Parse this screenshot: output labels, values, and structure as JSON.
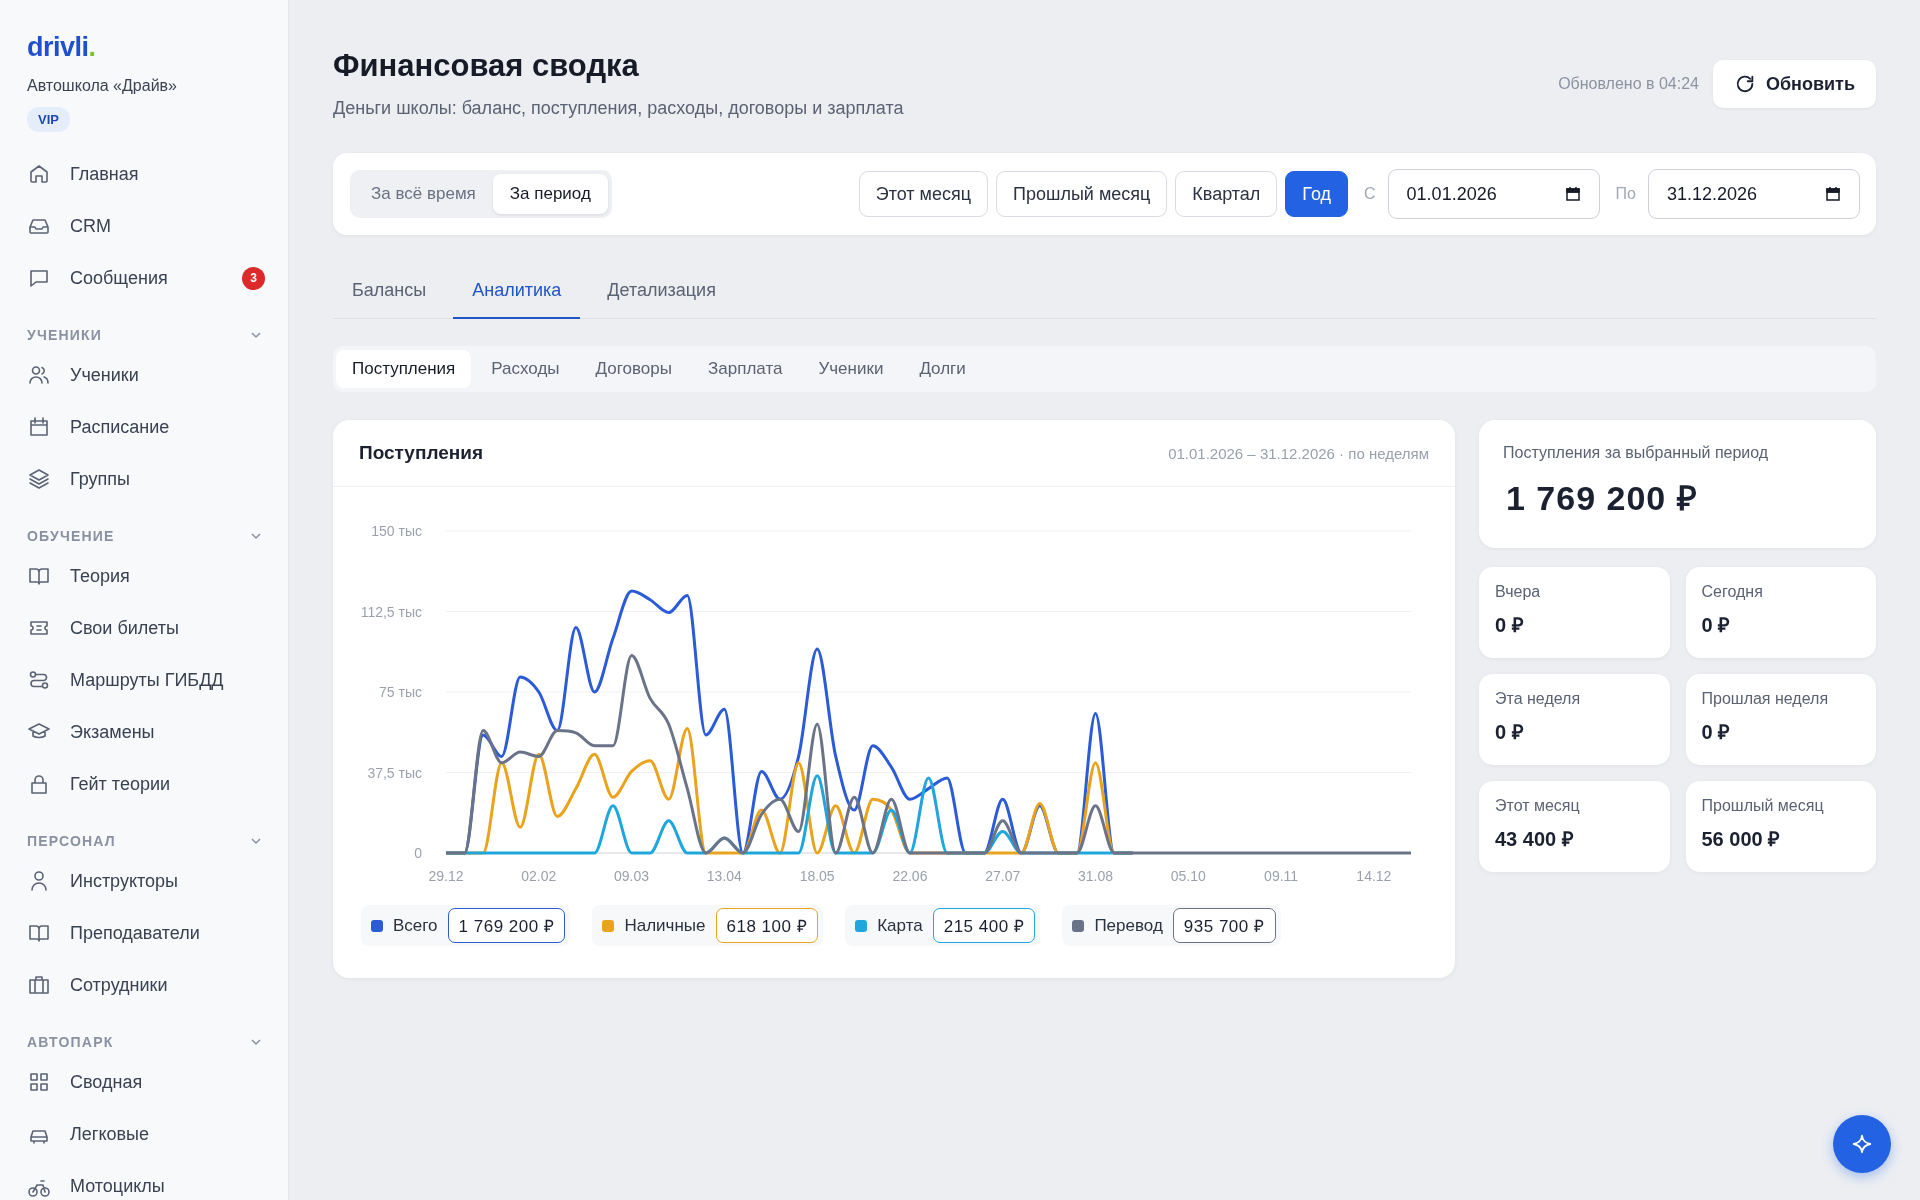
{
  "sidebar": {
    "logo": {
      "text": "drivli",
      "mark": "."
    },
    "school": "Автошкола «Драйв»",
    "plan": "VIP",
    "top_items": [
      {
        "label": "Главная"
      },
      {
        "label": "CRM"
      },
      {
        "label": "Сообщения",
        "badge": "3"
      }
    ],
    "sections": [
      {
        "title": "УЧЕНИКИ",
        "expanded": true,
        "items": [
          {
            "label": "Ученики"
          },
          {
            "label": "Расписание"
          },
          {
            "label": "Группы"
          }
        ]
      },
      {
        "title": "ОБУЧЕНИЕ",
        "expanded": true,
        "items": [
          {
            "label": "Теория"
          },
          {
            "label": "Свои билеты"
          },
          {
            "label": "Маршруты ГИБДД"
          },
          {
            "label": "Экзамены"
          },
          {
            "label": "Гейт теории"
          }
        ]
      },
      {
        "title": "ПЕРСОНАЛ",
        "expanded": true,
        "items": [
          {
            "label": "Инструкторы"
          },
          {
            "label": "Преподаватели"
          },
          {
            "label": "Сотрудники"
          }
        ]
      },
      {
        "title": "АВТОПАРК",
        "expanded": true,
        "items": [
          {
            "label": "Сводная"
          },
          {
            "label": "Легковые"
          },
          {
            "label": "Мотоциклы"
          }
        ]
      }
    ]
  },
  "header": {
    "title": "Финансовая сводка",
    "subtitle": "Деньги школы: баланс, поступления, расходы, договоры и зарплата",
    "updated": "Обновлено в 04:24",
    "refresh": "Обновить"
  },
  "filters": {
    "modes": [
      {
        "label": "За всё время",
        "selected": false
      },
      {
        "label": "За период",
        "selected": true
      }
    ],
    "presets": [
      {
        "label": "Этот месяц",
        "selected": false
      },
      {
        "label": "Прошлый месяц",
        "selected": false
      },
      {
        "label": "Квартал",
        "selected": false
      },
      {
        "label": "Год",
        "selected": true
      }
    ],
    "from_label": "С",
    "from": "01.01.2026",
    "to_label": "По",
    "to": "31.12.2026"
  },
  "tabs": [
    {
      "label": "Балансы",
      "selected": false
    },
    {
      "label": "Аналитика",
      "selected": true
    },
    {
      "label": "Детализация",
      "selected": false
    }
  ],
  "subtabs": [
    {
      "label": "Поступления",
      "selected": true
    },
    {
      "label": "Расходы",
      "selected": false
    },
    {
      "label": "Договоры",
      "selected": false
    },
    {
      "label": "Зарплата",
      "selected": false
    },
    {
      "label": "Ученики",
      "selected": false
    },
    {
      "label": "Долги",
      "selected": false
    }
  ],
  "chart_panel": {
    "title": "Поступления",
    "range": "01.01.2026 – 31.12.2026 · по неделям",
    "totals": [
      "1 769 200 ₽",
      "618 100 ₽",
      "215 400 ₽",
      "935 700 ₽"
    ],
    "chart_data": {
      "type": "line",
      "categories": [
        "29.12",
        null,
        null,
        null,
        null,
        "02.02",
        null,
        null,
        null,
        null,
        "09.03",
        null,
        null,
        null,
        null,
        "13.04",
        null,
        null,
        null,
        null,
        "18.05",
        null,
        null,
        null,
        null,
        "22.06",
        null,
        null,
        null,
        null,
        "27.07",
        null,
        null,
        null,
        null,
        "31.08",
        null,
        null,
        null,
        null,
        "05.10",
        null,
        null,
        null,
        null,
        "09.11",
        null,
        null,
        null,
        null,
        "14.12",
        null,
        null
      ],
      "ylim": [
        0,
        150
      ],
      "grid": true,
      "yticks": [
        {
          "value": 0,
          "label": "0"
        },
        {
          "value": 37.5,
          "label": "37,5 тыс"
        },
        {
          "value": 75,
          "label": "75 тыс"
        },
        {
          "value": 112.5,
          "label": "112,5 тыс"
        },
        {
          "value": 150,
          "label": "150 тыс"
        }
      ],
      "series": [
        {
          "name": "Всего",
          "color": "#2b5bd7",
          "values": [
            0,
            0,
            55,
            45,
            82,
            75,
            57,
            105,
            75,
            100,
            122,
            118,
            112,
            120,
            55,
            67,
            0,
            38,
            25,
            45,
            95,
            45,
            20,
            50,
            40,
            25,
            30,
            35,
            0,
            0,
            25,
            0,
            22,
            0,
            0,
            65,
            0,
            0,
            null,
            null,
            null,
            null,
            null,
            null,
            null,
            null,
            null,
            null,
            null,
            null,
            null,
            null,
            null
          ]
        },
        {
          "name": "Наличные",
          "color": "#e9a31c",
          "values": [
            0,
            0,
            0,
            42,
            12,
            46,
            17,
            30,
            46,
            26,
            38,
            43,
            25,
            58,
            0,
            0,
            0,
            20,
            0,
            42,
            0,
            22,
            0,
            25,
            20,
            0,
            0,
            0,
            0,
            0,
            0,
            0,
            23,
            0,
            0,
            42,
            0,
            0,
            null,
            null,
            null,
            null,
            null,
            null,
            null,
            null,
            null,
            null,
            null,
            null,
            null,
            null,
            null
          ]
        },
        {
          "name": "Карта",
          "color": "#1fa6dc",
          "values": [
            0,
            0,
            0,
            0,
            0,
            0,
            0,
            0,
            0,
            22,
            0,
            0,
            15,
            0,
            0,
            7,
            0,
            0,
            0,
            0,
            36,
            0,
            0,
            0,
            20,
            0,
            35,
            0,
            0,
            0,
            10,
            0,
            0,
            0,
            0,
            0,
            0,
            0,
            null,
            null,
            null,
            null,
            null,
            null,
            null,
            null,
            null,
            null,
            null,
            null,
            null,
            null,
            null
          ]
        },
        {
          "name": "Перевод",
          "color": "#6b7389",
          "values": [
            0,
            0,
            57,
            42,
            47,
            45,
            57,
            56,
            50,
            50,
            92,
            72,
            60,
            30,
            0,
            7,
            0,
            18,
            25,
            10,
            60,
            0,
            26,
            0,
            25,
            0,
            0,
            0,
            0,
            0,
            15,
            0,
            0,
            0,
            0,
            22,
            0,
            0,
            0,
            0,
            0,
            0,
            0,
            0,
            0,
            0,
            0,
            0,
            0,
            0,
            0,
            0,
            0
          ]
        }
      ]
    }
  },
  "summary": {
    "label": "Поступления за выбранный период",
    "value": "1 769 200 ₽"
  },
  "stats": [
    {
      "label": "Вчера",
      "value": "0 ₽"
    },
    {
      "label": "Сегодня",
      "value": "0 ₽"
    },
    {
      "label": "Эта неделя",
      "value": "0 ₽"
    },
    {
      "label": "Прошлая неделя",
      "value": "0 ₽"
    },
    {
      "label": "Этот месяц",
      "value": "43 400 ₽"
    },
    {
      "label": "Прошлый месяц",
      "value": "56 000 ₽"
    }
  ]
}
